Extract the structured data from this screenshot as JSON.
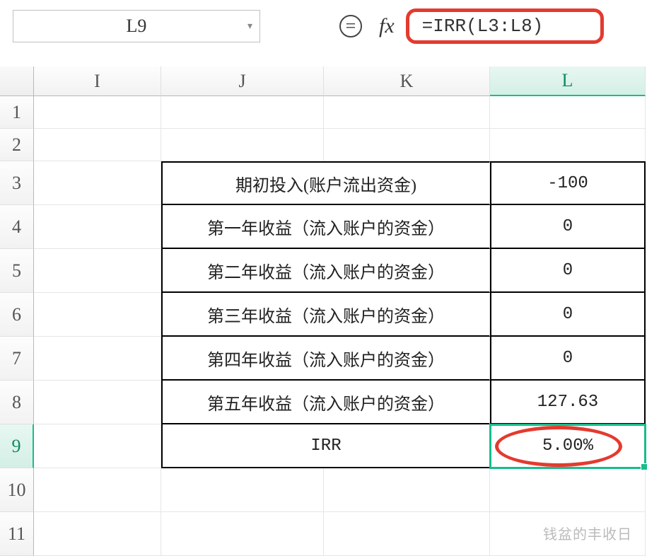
{
  "toolbar": {
    "name_box": "L9",
    "fx_label": "fx",
    "formula": "=IRR(L3:L8)"
  },
  "columns": {
    "I": "I",
    "J": "J",
    "K": "K",
    "L": "L"
  },
  "rows": [
    "1",
    "2",
    "3",
    "4",
    "5",
    "6",
    "7",
    "8",
    "9",
    "10",
    "11"
  ],
  "table": {
    "rows": [
      {
        "label": "期初投入(账户流出资金)",
        "value": "-100"
      },
      {
        "label": "第一年收益（流入账户的资金）",
        "value": "0"
      },
      {
        "label": "第二年收益（流入账户的资金）",
        "value": "0"
      },
      {
        "label": "第三年收益（流入账户的资金）",
        "value": "0"
      },
      {
        "label": "第四年收益（流入账户的资金）",
        "value": "0"
      },
      {
        "label": "第五年收益（流入账户的资金）",
        "value": "127.63"
      },
      {
        "label": "IRR",
        "value": "5.00%"
      }
    ]
  },
  "watermark": "钱盆的丰收日",
  "colors": {
    "highlight_red": "#e43a2f",
    "selection_green": "#1abc8c"
  }
}
